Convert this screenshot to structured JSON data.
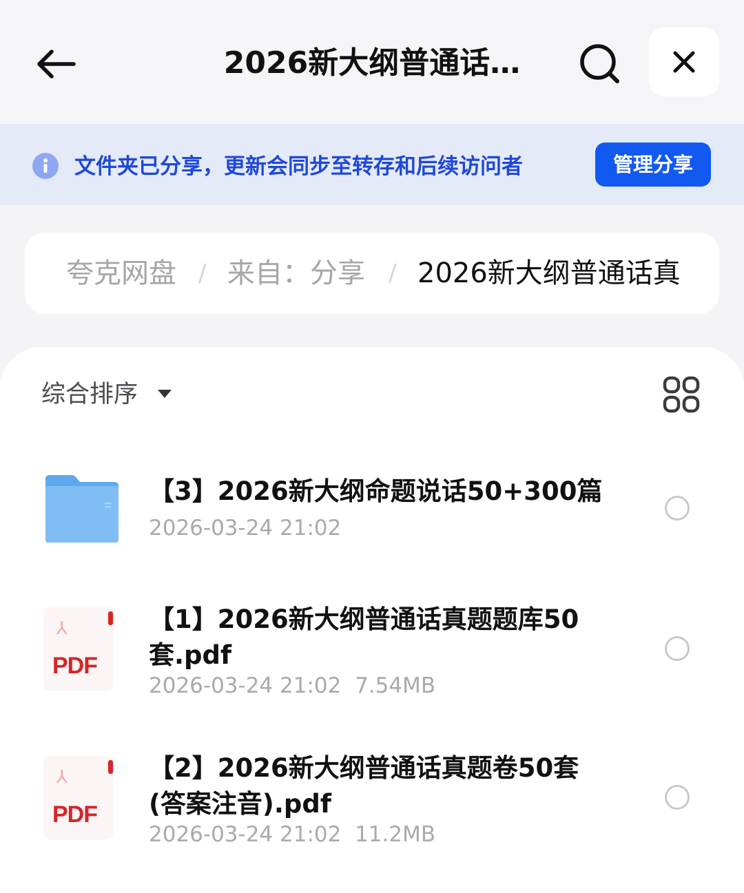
{
  "header": {
    "title": "2026新大纲普通话…",
    "back_icon": "arrow-left-icon",
    "search_icon": "search-icon",
    "close_icon": "close-icon"
  },
  "banner": {
    "text": "文件夹已分享，更新会同步至转存和后续访问者",
    "button_label": "管理分享",
    "info_icon": "info-icon",
    "accent_color": "#1259f2"
  },
  "breadcrumb": {
    "items": [
      "夸克网盘",
      "来自：分享",
      "2026新大纲普通话真"
    ],
    "separator": "/"
  },
  "toolbar": {
    "sort_label": "综合排序",
    "view_toggle_icon": "grid-view-icon"
  },
  "files": [
    {
      "type": "folder",
      "name": "【3】2026新大纲命题说话50+300篇",
      "date": "2026-03-24 21:02",
      "size": ""
    },
    {
      "type": "pdf",
      "name": "【1】2026新大纲普通话真题题库50套.pdf",
      "date": "2026-03-24 21:02",
      "size": "7.54MB",
      "icon_label": "PDF"
    },
    {
      "type": "pdf",
      "name": "【2】2026新大纲普通话真题卷50套(答案注音).pdf",
      "date": "2026-03-24 21:02",
      "size": "11.2MB",
      "icon_label": "PDF"
    }
  ]
}
